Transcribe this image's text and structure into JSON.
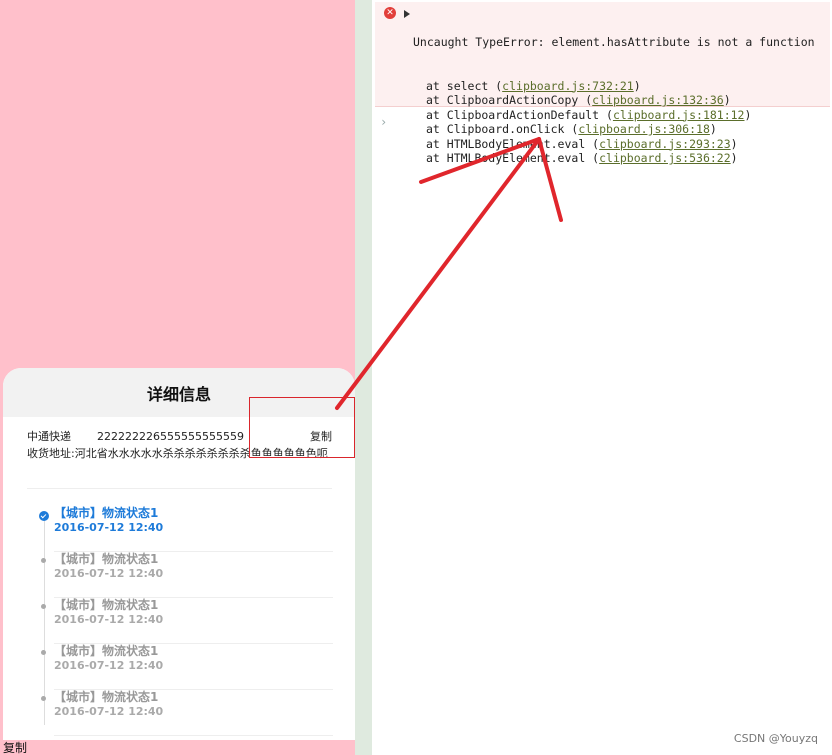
{
  "sheet": {
    "title": "详细信息",
    "courier": "中通快递",
    "tracking": "222222226555555555559",
    "copy_label": "复制",
    "address": "收货地址:河北省水水水水水杀杀杀杀杀杀杀杀鱼鱼鱼鱼鱼色呃"
  },
  "timeline": [
    {
      "status": "【城市】物流状态1",
      "time": "2016-07-12 12:40",
      "active": true
    },
    {
      "status": "【城市】物流状态1",
      "time": "2016-07-12 12:40",
      "active": false
    },
    {
      "status": "【城市】物流状态1",
      "time": "2016-07-12 12:40",
      "active": false
    },
    {
      "status": "【城市】物流状态1",
      "time": "2016-07-12 12:40",
      "active": false
    },
    {
      "status": "【城市】物流状态1",
      "time": "2016-07-12 12:40",
      "active": false
    }
  ],
  "bottom_copy_label": "复制",
  "console": {
    "error_icon": "x-circle-icon",
    "headline": "Uncaught TypeError: element.hasAttribute is not a function",
    "stack": [
      {
        "prefix": "at select (",
        "link": "clipboard.js:732:21",
        "suffix": ")"
      },
      {
        "prefix": "at ClipboardActionCopy (",
        "link": "clipboard.js:132:36",
        "suffix": ")"
      },
      {
        "prefix": "at ClipboardActionDefault (",
        "link": "clipboard.js:181:12",
        "suffix": ")"
      },
      {
        "prefix": "at Clipboard.onClick (",
        "link": "clipboard.js:306:18",
        "suffix": ")"
      },
      {
        "prefix": "at HTMLBodyElement.eval (",
        "link": "clipboard.js:293:23",
        "suffix": ")"
      },
      {
        "prefix": "at HTMLBodyElement.eval (",
        "link": "clipboard.js:536:22",
        "suffix": ")"
      }
    ],
    "prompt": "›"
  },
  "watermark": "CSDN @Youyzq",
  "colors": {
    "preview_bg": "#ffc0cb",
    "active_blue": "#1e7bd9",
    "annotation_red": "#d9262c",
    "error_bg": "#fdf0f0"
  }
}
